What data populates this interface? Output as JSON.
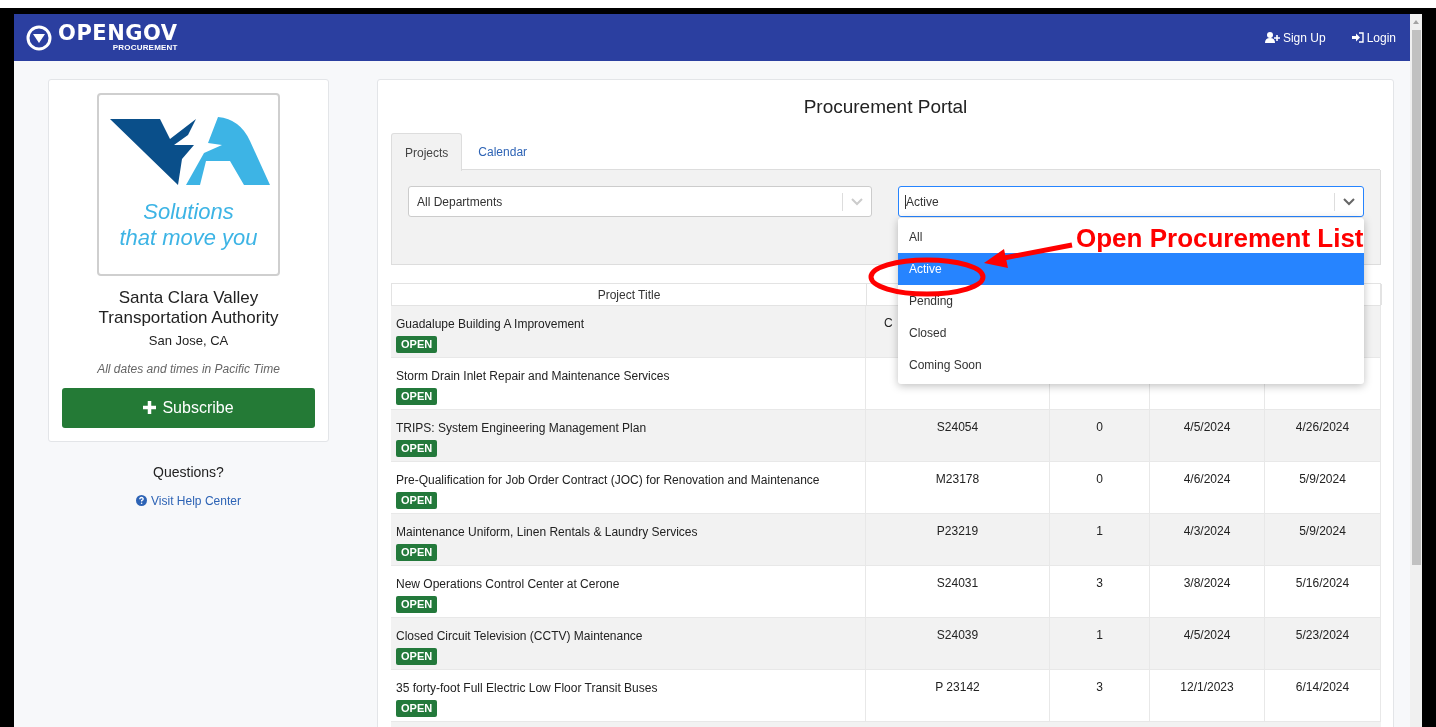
{
  "navbar": {
    "logo": "OPENGOV",
    "logo_sub": "PROCUREMENT",
    "links": [
      {
        "kind": "signup",
        "label": "Sign Up"
      },
      {
        "kind": "login",
        "label": "Login"
      }
    ]
  },
  "sidebar": {
    "logo_tagline_1": "Solutions",
    "logo_tagline_2": "that move you",
    "org_name": "Santa Clara Valley Transportation Authority",
    "location": "San Jose, CA",
    "timezone_note": "All dates and times in Pacific Time",
    "subscribe": "Subscribe",
    "questions": "Questions?",
    "help_link": "Visit Help Center"
  },
  "portal": {
    "title": "Procurement Portal",
    "tabs": [
      {
        "label": "Projects",
        "selected": true
      },
      {
        "label": "Calendar",
        "selected": false
      }
    ],
    "department_select": {
      "value": "All Departments"
    },
    "status_select": {
      "value": "Active",
      "expanded": true,
      "options": [
        {
          "label": "All",
          "selected": false
        },
        {
          "label": "Active",
          "selected": true
        },
        {
          "label": "Pending",
          "selected": false
        },
        {
          "label": "Closed",
          "selected": false
        },
        {
          "label": "Coming Soon",
          "selected": false
        }
      ]
    },
    "table": {
      "columns": [
        "Project Title"
      ],
      "rows": [
        {
          "title": "Guadalupe Building A Improvement",
          "status": "OPEN",
          "partial_cell": "C"
        },
        {
          "title": "Storm Drain Inlet Repair and Maintenance Services",
          "status": "OPEN"
        },
        {
          "title": "TRIPS: System Engineering Management Plan",
          "status": "OPEN",
          "cells": [
            "S24054",
            "0",
            "4/5/2024",
            "4/26/2024"
          ]
        },
        {
          "title": "Pre-Qualification for Job Order Contract (JOC) for Renovation and Maintenance",
          "status": "OPEN",
          "cells": [
            "M23178",
            "0",
            "4/6/2024",
            "5/9/2024"
          ]
        },
        {
          "title": "Maintenance Uniform, Linen Rentals & Laundry Services",
          "status": "OPEN",
          "cells": [
            "P23219",
            "1",
            "4/3/2024",
            "5/9/2024"
          ]
        },
        {
          "title": "New Operations Control Center at Cerone",
          "status": "OPEN",
          "cells": [
            "S24031",
            "3",
            "3/8/2024",
            "5/16/2024"
          ]
        },
        {
          "title": "Closed Circuit Television (CCTV) Maintenance",
          "status": "OPEN",
          "cells": [
            "S24039",
            "1",
            "4/5/2024",
            "5/23/2024"
          ]
        },
        {
          "title": "35 forty-foot Full Electric Low Floor Transit Buses",
          "status": "OPEN",
          "cells": [
            "P 23142",
            "3",
            "12/1/2023",
            "6/14/2024"
          ]
        }
      ]
    }
  },
  "annotation": {
    "label": "Open Procurement List"
  }
}
